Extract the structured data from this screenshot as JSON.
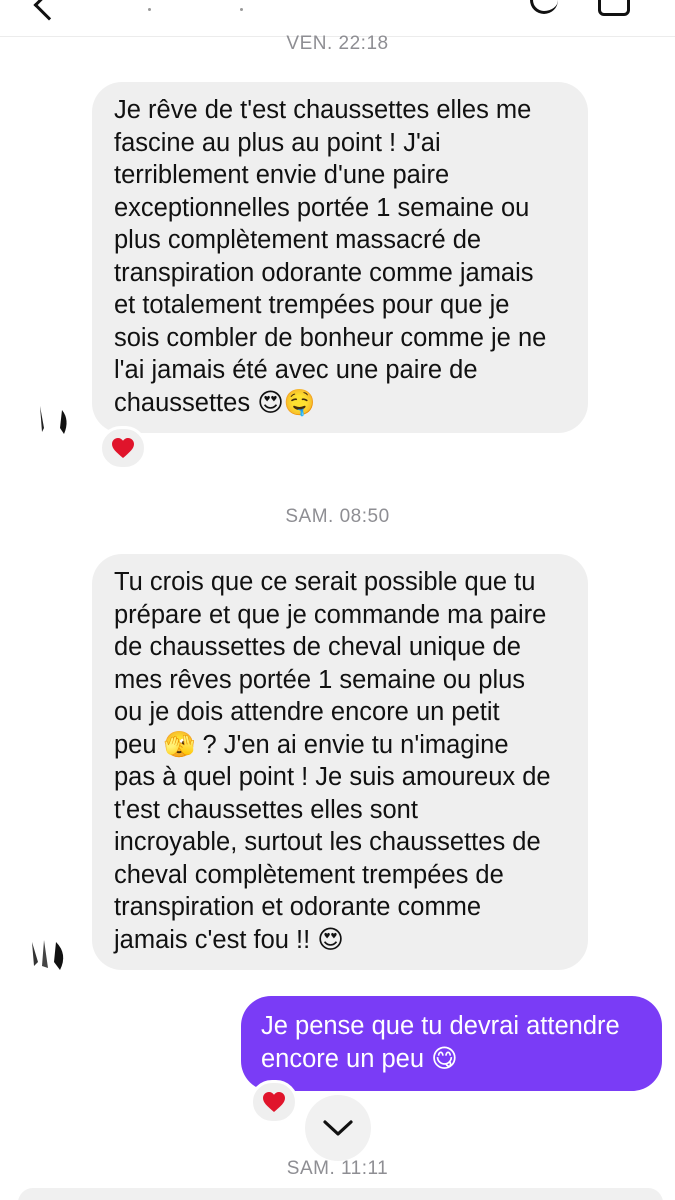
{
  "timestamps": {
    "t1": "VEN. 22:18",
    "t2": "SAM. 08:50",
    "t3": "SAM. 11:11"
  },
  "messages": [
    {
      "direction": "incoming",
      "lines": [
        "Je rêve de t'est chaussettes elles me",
        "fascine au plus au point ! J'ai",
        "terriblement envie d'une paire",
        "exceptionnelles portée 1 semaine ou",
        "plus complètement massacré de",
        "transpiration odorante comme jamais",
        "et totalement trempées pour que je",
        "sois combler de bonheur comme je ne",
        "l'ai jamais été avec une paire de",
        "chaussettes"
      ],
      "last_emoji": "😍🤤",
      "reaction": "❤️"
    },
    {
      "direction": "incoming",
      "lines": [
        "Tu crois que ce serait possible que tu",
        "prépare et que je commande ma paire",
        "de chaussettes de cheval unique de",
        "mes rêves portée 1 semaine ou plus",
        "ou je dois attendre encore un petit",
        "peu",
        "pas à quel point ! Je suis amoureux de",
        "t'est chaussettes elles sont",
        "incroyable, surtout les chaussettes de",
        "cheval  complètement trempées de",
        "transpiration et odorante comme",
        "jamais c'est fou !!"
      ],
      "line6_emoji": "🫣",
      "line6_rest": " ? J'en ai envie tu n'imagine",
      "last_emoji": "😍"
    },
    {
      "direction": "outgoing",
      "lines": [
        "Je pense que tu devrai attendre",
        "encore un peu"
      ],
      "last_emoji": "😋",
      "reaction": "❤️"
    }
  ],
  "colors": {
    "incoming_bubble": "#efefef",
    "outgoing_bubble": "#7a3cf6",
    "timestamp_text": "#8e8e93",
    "heart": "#e0142b"
  },
  "icons": {
    "scroll_down": "chevron-down-icon",
    "reaction": "heart-icon"
  }
}
